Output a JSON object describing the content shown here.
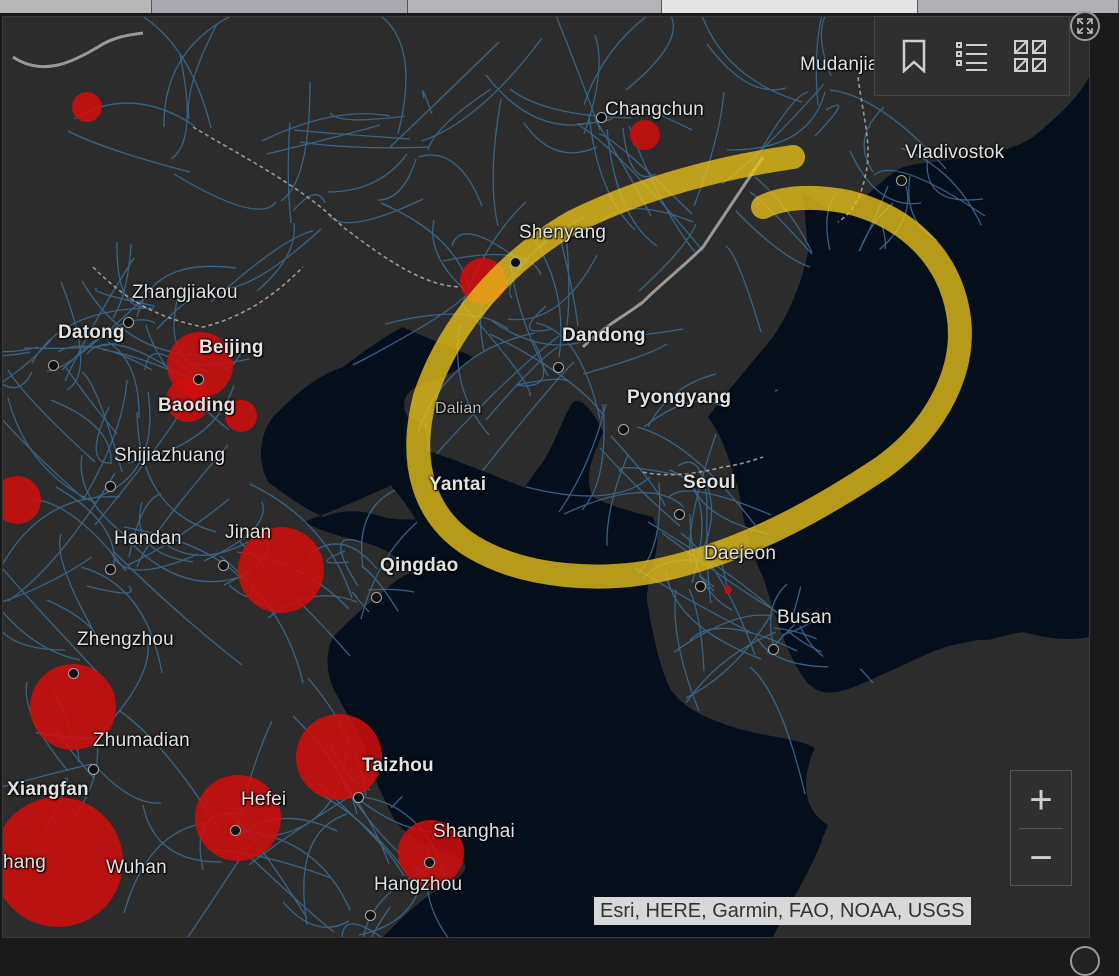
{
  "tabs": [
    {
      "color": "#b8b8b8",
      "width": 152
    },
    {
      "color": "#a8a8b0",
      "width": 256
    },
    {
      "color": "#b4b4b8",
      "width": 254
    },
    {
      "color": "#e4e4e6",
      "width": 256
    },
    {
      "color": "#b0b0b4",
      "width": 201
    }
  ],
  "colors": {
    "land": "#2c2c2c",
    "water": "#050f1c",
    "roads": "#3c6e94",
    "borders": "#bdbdbd",
    "case_circle": "#d20d0d",
    "highlight": "#e9c21a"
  },
  "cities": [
    {
      "name": "Changchun",
      "bold": false
    },
    {
      "name": "Mudanjiang",
      "bold": false
    },
    {
      "name": "Vladivostok",
      "bold": false
    },
    {
      "name": "Shenyang",
      "bold": false
    },
    {
      "name": "Zhangjiakou",
      "bold": false
    },
    {
      "name": "Datong",
      "bold": true
    },
    {
      "name": "Beijing",
      "bold": true
    },
    {
      "name": "Baoding",
      "bold": true
    },
    {
      "name": "Dandong",
      "bold": true
    },
    {
      "name": "Pyongyang",
      "bold": true
    },
    {
      "name": "Dalian",
      "bold": false
    },
    {
      "name": "Shijiazhuang",
      "bold": false
    },
    {
      "name": "Yantai",
      "bold": true
    },
    {
      "name": "Seoul",
      "bold": true
    },
    {
      "name": "Handan",
      "bold": false
    },
    {
      "name": "Jinan",
      "bold": false
    },
    {
      "name": "Qingdao",
      "bold": true
    },
    {
      "name": "Daejeon",
      "bold": false
    },
    {
      "name": "Busan",
      "bold": false
    },
    {
      "name": "Zhengzhou",
      "bold": false
    },
    {
      "name": "Zhumadian",
      "bold": false
    },
    {
      "name": "Xiangfan",
      "bold": true
    },
    {
      "name": "Taizhou",
      "bold": true
    },
    {
      "name": "Hefei",
      "bold": false
    },
    {
      "name": "Shanghai",
      "bold": false
    },
    {
      "name": "Wuhan",
      "bold": false
    },
    {
      "name": "Hangzhou",
      "bold": false
    },
    {
      "name": "hang",
      "bold": false
    }
  ],
  "toolbar": {
    "bookmark_icon": "bookmark-icon",
    "legend_icon": "legend-list-icon",
    "basemap_icon": "basemap-gallery-icon"
  },
  "zoom": {
    "in_label": "+",
    "out_label": "−"
  },
  "attribution": "Esri, HERE, Garmin, FAO, NOAA, USGS"
}
